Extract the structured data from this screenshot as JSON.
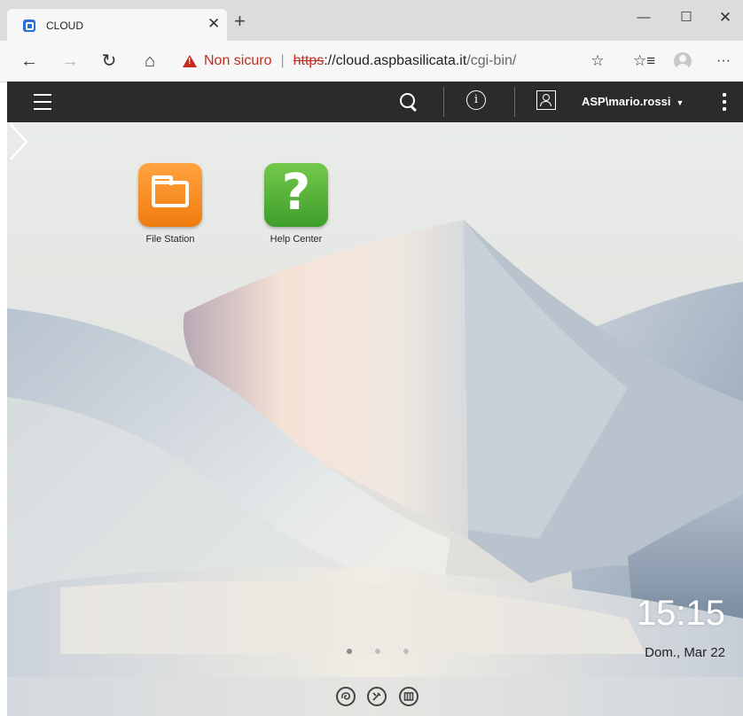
{
  "browser": {
    "tab_title": "CLOUD",
    "tab_close": "✕",
    "new_tab": "+",
    "window": {
      "minimize": "—",
      "maximize": "☐",
      "close": "✕"
    },
    "nav": {
      "back": "←",
      "forward": "→",
      "reload": "↻",
      "home": "⌂"
    },
    "address": {
      "warning_text": "Non sicuro",
      "separator": "|",
      "scheme": "https",
      "host_part": "://cloud.aspbasilicata.it",
      "path_part": "/cgi-bin/"
    },
    "toolbar_icons": {
      "star": "☆",
      "favorites": "☆≡",
      "more": "···"
    },
    "colors": {
      "warning": "#c42b1c",
      "favicon": "#2a6fd6"
    }
  },
  "appbar": {
    "info_glyph": "i",
    "username": "ASP\\mario.rossi",
    "caret": "▼"
  },
  "desktop": {
    "apps": [
      {
        "label": "File Station",
        "icon": "folder-icon",
        "color": "#f28a1e"
      },
      {
        "label": "Help Center",
        "icon": "question-icon",
        "color": "#52b03a"
      }
    ],
    "clock": {
      "time": "15:15",
      "date": "Dom., Mar 22"
    },
    "pager": {
      "pages": 3,
      "active": 1
    },
    "dock_icons": [
      "circle-swirl-icon",
      "tools-icon",
      "columns-icon"
    ]
  }
}
